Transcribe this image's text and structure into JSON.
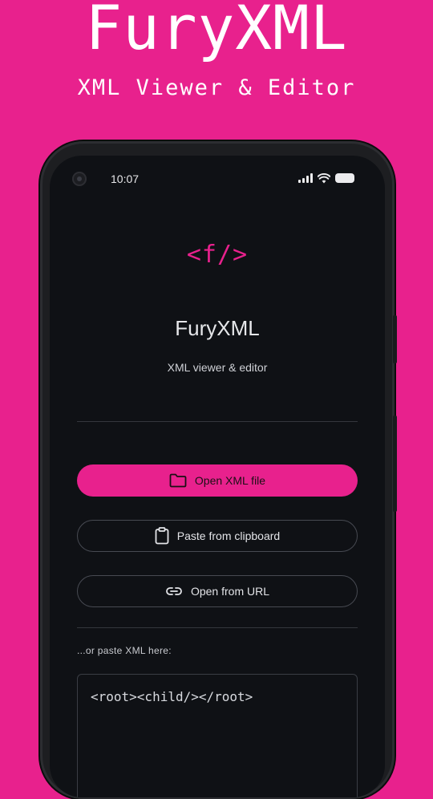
{
  "promo": {
    "title": "FuryXML",
    "subtitle": "XML Viewer & Editor"
  },
  "status_bar": {
    "time": "10:07",
    "icons": [
      "signal-icon",
      "wifi-icon",
      "battery-icon"
    ]
  },
  "app": {
    "logo": "<f/>",
    "name": "FuryXML",
    "tagline": "XML viewer & editor"
  },
  "actions": {
    "open_file_label": "Open XML file",
    "open_file_icon": "folder-icon",
    "paste_clipboard_label": "Paste from clipboard",
    "paste_clipboard_icon": "clipboard-icon",
    "open_url_label": "Open from URL",
    "open_url_icon": "link-icon"
  },
  "paste_area": {
    "label": "...or paste XML here:",
    "value": "<root><child/></root>"
  },
  "colors": {
    "accent": "#E8218D",
    "background": "#0F1115",
    "promo_background": "#E8218D"
  }
}
